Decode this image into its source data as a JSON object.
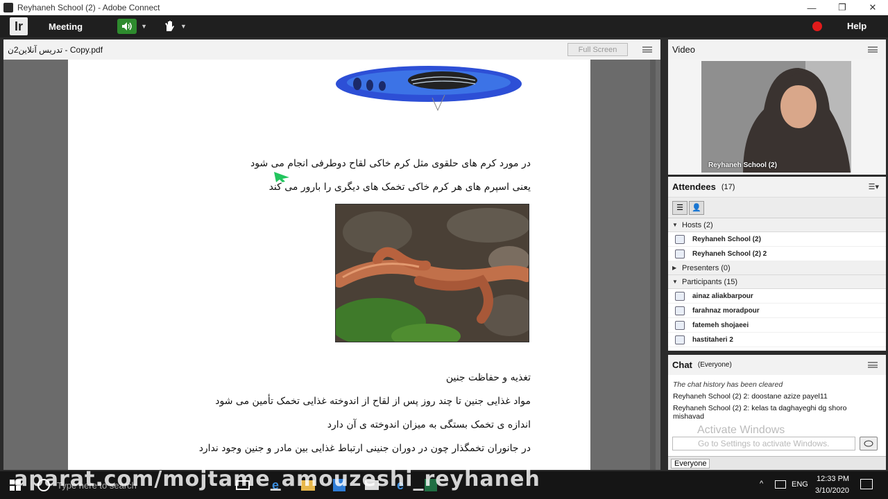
{
  "window": {
    "title": "Reyhaneh School (2) - Adobe Connect",
    "minimize": "—",
    "restore": "❐",
    "close": "✕"
  },
  "menubar": {
    "meeting_label": "Meeting",
    "help_label": "Help",
    "logo": "Ir",
    "record_color": "#e11b1b",
    "speaker_color": "#2e8b2e"
  },
  "share": {
    "filename": "تدریس آنلاین2ن - Copy.pdf",
    "full_screen_label": "Full Screen",
    "lines": [
      "در مورد کرم های حلقوی مثل کرم خاکی لقاح دوطرفی انجام می شود",
      "یعنی اسپرم های هر کرم خاکی تخمک های دیگری را بارور می کند",
      "تغذیه و حفاظت جنین",
      "مواد غذایی جنین تا چند روز پس از لقاح از اندوخته غذایی تخمک تأمین می شود",
      "اندازه ی تخمک بستگی به میزان اندوخته ی آن دارد",
      "در جانوران تخمگذار چون در دوران جنینی ارتباط غذایی بین مادر و جنین وجود ندارد"
    ]
  },
  "video": {
    "title": "Video",
    "label": "Reyhaneh School (2)"
  },
  "attendees": {
    "title": "Attendees",
    "count": "(17)",
    "hosts_label": "Hosts (2)",
    "hosts": [
      "Reyhaneh School (2)",
      "Reyhaneh School (2) 2"
    ],
    "presenters_label": "Presenters (0)",
    "participants_label": "Participants (15)",
    "participants": [
      "ainaz aliakbarpour",
      "farahnaz moradpour",
      "fatemeh shojaeei",
      "hastitaheri 2"
    ]
  },
  "chat": {
    "title": "Chat",
    "scope": "(Everyone)",
    "cleared": "The chat history has been cleared",
    "messages": [
      "Reyhaneh School (2) 2: doostane azize payel11",
      "Reyhaneh School (2) 2: kelas ta daghayeghi dg shoro mishavad"
    ],
    "activate_title": "Activate Windows",
    "input_placeholder": "Go to Settings to activate Windows.",
    "recipient": "Everyone"
  },
  "taskbar": {
    "search_placeholder": "Type here to search",
    "lang": "ENG",
    "time": "12:33 PM",
    "date": "3/10/2020"
  },
  "watermark": "aparat.com/mojtame_amouzeshi_reyhaneh"
}
